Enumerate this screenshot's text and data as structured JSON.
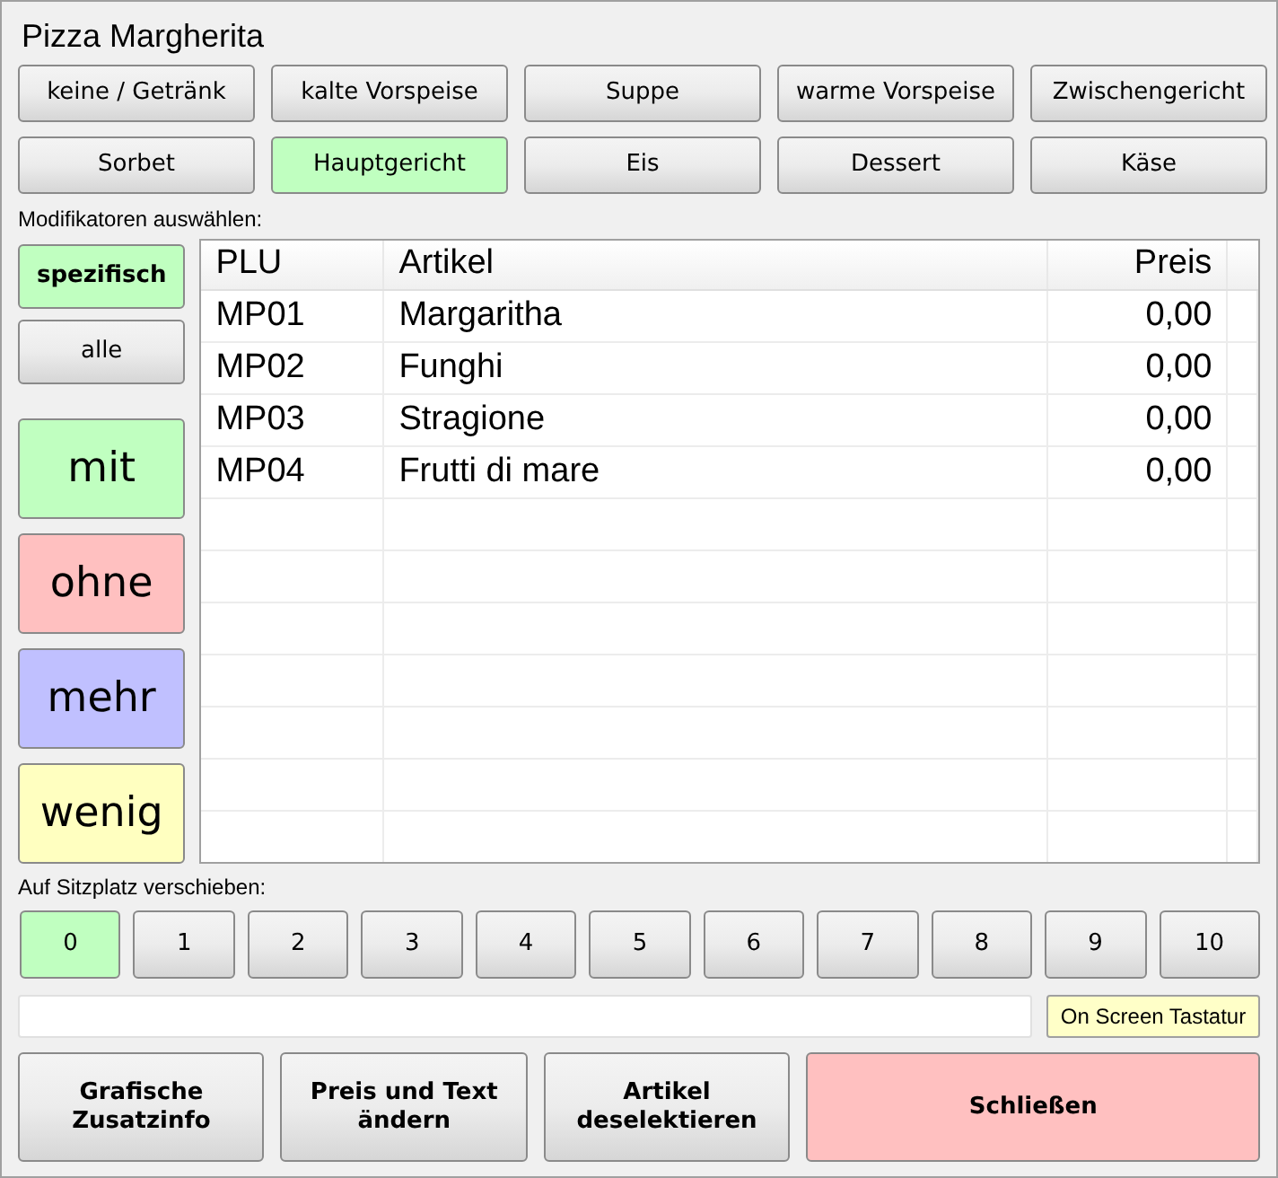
{
  "window": {
    "title": "Pizza Margherita"
  },
  "courses": [
    {
      "label": "keine / Getränk",
      "selected": false
    },
    {
      "label": "kalte Vorspeise",
      "selected": false
    },
    {
      "label": "Suppe",
      "selected": false
    },
    {
      "label": "warme Vorspeise",
      "selected": false
    },
    {
      "label": "Zwischengericht",
      "selected": false
    },
    {
      "label": "Sorbet",
      "selected": false
    },
    {
      "label": "Hauptgericht",
      "selected": true
    },
    {
      "label": "Eis",
      "selected": false
    },
    {
      "label": "Dessert",
      "selected": false
    },
    {
      "label": "Käse",
      "selected": false
    }
  ],
  "modifier_label": "Modifikatoren auswählen:",
  "filters": [
    {
      "label": "spezifisch",
      "selected": true
    },
    {
      "label": "alle",
      "selected": false
    }
  ],
  "modifiers": [
    {
      "label": "mit",
      "color": "#c0ffc0"
    },
    {
      "label": "ohne",
      "color": "#ffc0c0"
    },
    {
      "label": "mehr",
      "color": "#c0c0ff"
    },
    {
      "label": "wenig",
      "color": "#ffffc0"
    }
  ],
  "table": {
    "columns": [
      "PLU",
      "Artikel",
      "Preis"
    ],
    "rows": [
      [
        "MP01",
        "Margaritha",
        "0,00"
      ],
      [
        "MP02",
        "Funghi",
        "0,00"
      ],
      [
        "MP03",
        "Stragione",
        "0,00"
      ],
      [
        "MP04",
        "Frutti di mare",
        "0,00"
      ]
    ]
  },
  "seat_label": "Auf Sitzplatz verschieben:",
  "seats": [
    {
      "label": "0",
      "selected": true
    },
    {
      "label": "1",
      "selected": false
    },
    {
      "label": "2",
      "selected": false
    },
    {
      "label": "3",
      "selected": false
    },
    {
      "label": "4",
      "selected": false
    },
    {
      "label": "5",
      "selected": false
    },
    {
      "label": "6",
      "selected": false
    },
    {
      "label": "7",
      "selected": false
    },
    {
      "label": "8",
      "selected": false
    },
    {
      "label": "9",
      "selected": false
    },
    {
      "label": "10",
      "selected": false
    }
  ],
  "keyboard_button": "On Screen Tastatur",
  "actions": [
    {
      "label": "Grafische Zusatzinfo",
      "kind": "normal"
    },
    {
      "label": "Preis und Text ändern",
      "kind": "normal"
    },
    {
      "label": "Artikel deselektieren",
      "kind": "normal"
    },
    {
      "label": "Schließen",
      "kind": "close"
    }
  ]
}
